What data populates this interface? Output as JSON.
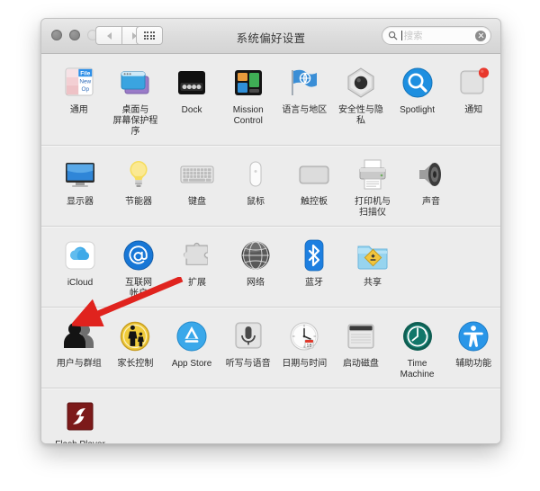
{
  "window": {
    "title": "系统偏好设置",
    "traffic_lights": [
      "close",
      "minimize",
      "zoom"
    ],
    "nav_back": "back",
    "nav_forward": "forward",
    "show_all": "show-all-grid"
  },
  "search": {
    "value": "",
    "placeholder": "搜索"
  },
  "annotation": {
    "color": "#e0231e",
    "points_to": "用户与群组"
  },
  "rows": [
    {
      "id": "personal",
      "items": [
        {
          "label": "通用",
          "icon": "general-icon"
        },
        {
          "label": "桌面与\n屏幕保护程序",
          "icon": "desktop-screensaver-icon"
        },
        {
          "label": "Dock",
          "icon": "dock-icon"
        },
        {
          "label": "Mission\nControl",
          "icon": "mission-control-icon"
        },
        {
          "label": "语言与地区",
          "icon": "language-region-icon"
        },
        {
          "label": "安全性与隐私",
          "icon": "security-privacy-icon"
        },
        {
          "label": "Spotlight",
          "icon": "spotlight-icon"
        },
        {
          "label": "通知",
          "icon": "notifications-icon",
          "badge": true
        }
      ]
    },
    {
      "id": "hardware",
      "items": [
        {
          "label": "显示器",
          "icon": "displays-icon"
        },
        {
          "label": "节能器",
          "icon": "energy-saver-icon"
        },
        {
          "label": "键盘",
          "icon": "keyboard-icon"
        },
        {
          "label": "鼠标",
          "icon": "mouse-icon"
        },
        {
          "label": "触控板",
          "icon": "trackpad-icon"
        },
        {
          "label": "打印机与\n扫描仪",
          "icon": "printers-scanners-icon"
        },
        {
          "label": "声音",
          "icon": "sound-icon"
        }
      ]
    },
    {
      "id": "internet-wireless",
      "items": [
        {
          "label": "iCloud",
          "icon": "icloud-icon"
        },
        {
          "label": "互联网\n帐户",
          "icon": "internet-accounts-icon"
        },
        {
          "label": "扩展",
          "icon": "extensions-icon"
        },
        {
          "label": "网络",
          "icon": "network-icon"
        },
        {
          "label": "蓝牙",
          "icon": "bluetooth-icon"
        },
        {
          "label": "共享",
          "icon": "sharing-icon"
        }
      ]
    },
    {
      "id": "system",
      "items": [
        {
          "label": "用户与群组",
          "icon": "users-groups-icon"
        },
        {
          "label": "家长控制",
          "icon": "parental-controls-icon"
        },
        {
          "label": "App Store",
          "icon": "app-store-icon"
        },
        {
          "label": "听写与语音",
          "icon": "dictation-speech-icon"
        },
        {
          "label": "日期与时间",
          "icon": "date-time-icon"
        },
        {
          "label": "启动磁盘",
          "icon": "startup-disk-icon"
        },
        {
          "label": "Time Machine",
          "icon": "time-machine-icon"
        },
        {
          "label": "辅助功能",
          "icon": "accessibility-icon"
        }
      ]
    },
    {
      "id": "other",
      "items": [
        {
          "label": "Flash Player",
          "icon": "flash-player-icon"
        }
      ]
    }
  ]
}
